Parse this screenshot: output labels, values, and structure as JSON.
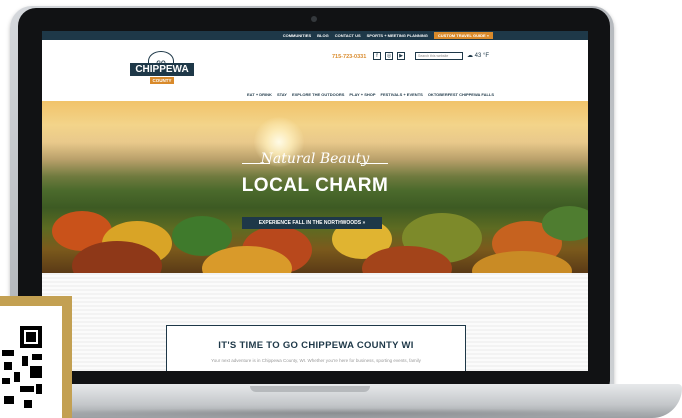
{
  "topbar": {
    "links": [
      "COMMUNITIES",
      "BLOG",
      "CONTACT US",
      "SPORTS + MEETING PLANNING"
    ],
    "cta_label": "CUSTOM TRAVEL GUIDE »"
  },
  "header": {
    "logo": {
      "go": "GO",
      "name": "CHIPPEWA",
      "county": "COUNTY"
    },
    "phone": "715-723-0331",
    "social_icons": [
      "facebook-icon",
      "instagram-icon",
      "youtube-icon"
    ],
    "search_placeholder": "Search this website",
    "weather_temp": "43 °F",
    "weather_icon": "cloud-icon"
  },
  "nav": {
    "items": [
      "EAT + DRINK",
      "STAY",
      "EXPLORE THE OUTDOORS",
      "PLAY + SHOP",
      "FESTIVALS + EVENTS",
      "OKTOBERFEST CHIPPEWA FALLS"
    ]
  },
  "hero": {
    "script_text": "Natural Beauty",
    "title": "LOCAL CHARM",
    "button_label": "EXPERIENCE FALL IN THE NORTHWOODS »"
  },
  "intro": {
    "title": "IT'S TIME TO GO CHIPPEWA COUNTY WI",
    "text": "Your next adventure is in Chippewa County, WI. Whether you're here for business, sporting events, family"
  },
  "colors": {
    "brand_navy": "#1e3848",
    "brand_orange": "#d98a2b",
    "qr_frame": "#c3a052"
  }
}
